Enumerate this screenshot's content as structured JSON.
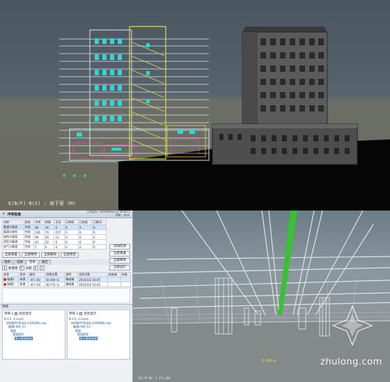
{
  "top_view": {
    "status_text": "E(B/F)-B(X) : 地下室 (M)"
  },
  "clash_panel": {
    "title": "冲突检查",
    "meta_line1": "上次运行: 2016年2月2日 16:45:1",
    "meta_line2": "冲突 - 总计:",
    "tabs": [
      "规则",
      "选择",
      "结果",
      "报告"
    ],
    "active_tab": 2,
    "summary_headers": [
      "名称",
      "状态",
      "冲突",
      "新建",
      "活动",
      "已审阅",
      "已核准",
      "已解决"
    ],
    "summary_rows": [
      [
        "暖通与管道",
        "完成",
        "84",
        "16",
        "0",
        "0",
        "0",
        "0"
      ],
      [
        "暖通与结构",
        "完成",
        "236",
        "79",
        "157",
        "0",
        "0",
        "0"
      ],
      [
        "结构与管道",
        "完成",
        "90",
        "30",
        "11",
        "0",
        "0",
        "0"
      ],
      [
        "消防与暖通",
        "完成",
        "43",
        "32",
        "0",
        "0",
        "0",
        "0"
      ],
      [
        "电气与暖通",
        "完成",
        "7",
        "0",
        "0",
        "0",
        "0",
        "0"
      ]
    ],
    "selected_summary_row": 0,
    "side_buttons": [
      "添加检测",
      "全部重置",
      "全部精简",
      "全部运行"
    ],
    "action_buttons": [
      "全部重置",
      "全部精简",
      "全部删除",
      "全部更新"
    ],
    "tools": [
      "新建组",
      "分配"
    ],
    "detail_headers": [
      "名称",
      "状态",
      "级别",
      "网格位置",
      "说明",
      "找到日期",
      "核准者",
      "核准"
    ],
    "detail_rows": [
      {
        "name": "碰撞1",
        "status": "新建",
        "level": "-4F(-16)",
        "grid": "B1-B4(-1)",
        "note": "硬碰撞",
        "date": "2016/2/2 16:45"
      },
      {
        "name": "碰撞2",
        "status": "新建",
        "level": "-4F(-16)",
        "grid": "B2-F5(-1)",
        "note": "硬碰撞",
        "date": "2016/2/2 16:45"
      }
    ],
    "section_label": "项目",
    "tree_left": {
      "label": "项目 1",
      "toggle": "高亮显示",
      "nodes": [
        "B-1.5 -1.Level",
        "WSMEP-PD-B4-1(HXFAN).nwc",
        "暖通(-B4(-1))",
        "管道",
        "管道类型",
        "默认管道系统"
      ]
    },
    "tree_right": {
      "label": "项目 2",
      "toggle": "高亮显示",
      "nodes": [
        "B-1.5 -1.Level",
        "WSMEP-PD-B4-1(HXFAN).nwc",
        "暖通(-B4(-1))",
        "管道",
        "管道类型",
        "默认管道系统"
      ]
    }
  },
  "mep_view": {
    "measure_label": "5.296 m",
    "status_text": "B3-F8 B0: 1 ST4 B0X",
    "watermark": "zhulong.com"
  }
}
